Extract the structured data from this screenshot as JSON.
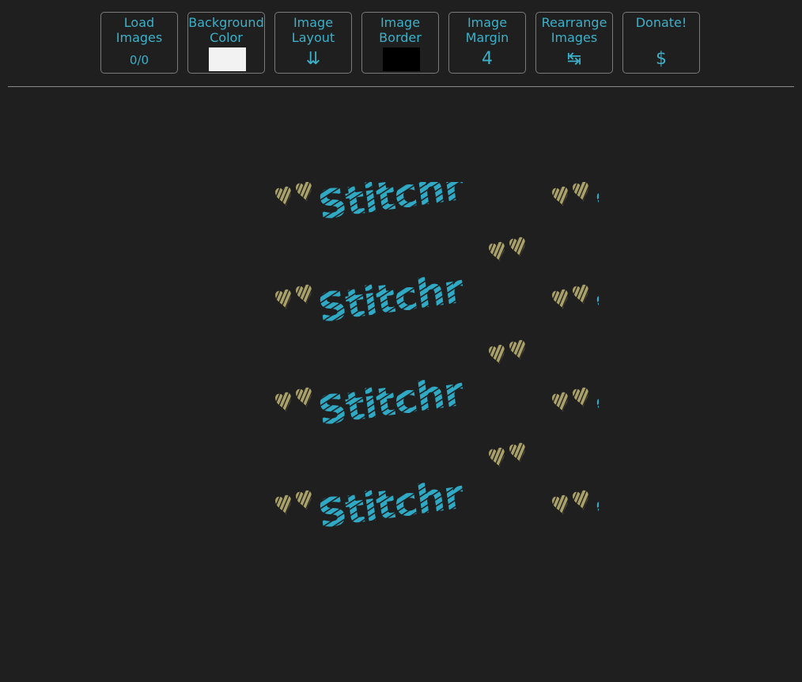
{
  "toolbar": {
    "load": {
      "label_line1": "Load",
      "label_line2": "Images",
      "value": "0/0"
    },
    "background": {
      "label_line1": "Background",
      "label_line2": "Color",
      "color": "#f2f2f2"
    },
    "layout": {
      "label_line1": "Image",
      "label_line2": "Layout",
      "icon": "⇊",
      "icon_name": "double-down-arrow-icon"
    },
    "border": {
      "label_line1": "Image",
      "label_line2": "Border",
      "color": "#000000"
    },
    "margin": {
      "label_line1": "Image",
      "label_line2": "Margin",
      "value": "4"
    },
    "rearrange": {
      "label_line1": "Rearrange",
      "label_line2": "Images",
      "icon": "↹",
      "icon_name": "tab-arrows-icon"
    },
    "donate": {
      "label_line1": "Donate!",
      "label_line2": "",
      "icon": "$",
      "icon_name": "dollar-icon"
    }
  },
  "canvas": {
    "tile_text": "Stitchr",
    "text_color": "#2fa9c4",
    "heart_color": "#a9a06a"
  }
}
